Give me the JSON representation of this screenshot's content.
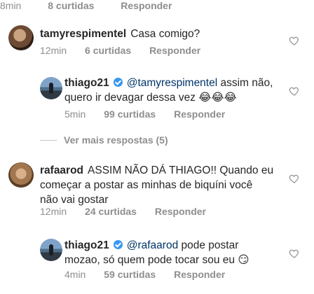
{
  "prev_meta": {
    "time": "8min",
    "likes": "8 curtidas",
    "reply": "Responder"
  },
  "comments": [
    {
      "user": "tamyrespimentel",
      "text": "Casa comigo?",
      "time": "12min",
      "likes": "6 curtidas",
      "reply": "Responder"
    },
    {
      "user": "thiago21",
      "mention": "@tamyrespimentel",
      "text_line1": " assim não,",
      "text_line2": "quero ir devagar dessa vez ",
      "emoji": "😂😂😂",
      "time": "5min",
      "likes": "99 curtidas",
      "reply": "Responder"
    },
    {
      "user": "rafaarod",
      "text_line1": "ASSIM NÃO DÁ THIAGO!! Quando eu",
      "text_line2": "começar a postar as minhas de biquíni você",
      "text_line3": "não vai gostar",
      "time": "12min",
      "likes": "24 curtidas",
      "reply": "Responder"
    },
    {
      "user": "thiago21",
      "mention": "@rafaarod",
      "text_line1": " pode postar",
      "text_line2": "mozao, só quem pode tocar sou eu ",
      "emoji": "😏",
      "time": "4min",
      "likes": "59 curtidas",
      "reply": "Responder"
    }
  ],
  "view_more": "Ver mais respostas (5)",
  "colors": {
    "text": "#262626",
    "meta": "#8e8e8e",
    "mention": "#003569",
    "verified": "#3897f0"
  },
  "icons": {
    "like": "heart-outline-icon",
    "verified": "verified-badge-icon"
  }
}
